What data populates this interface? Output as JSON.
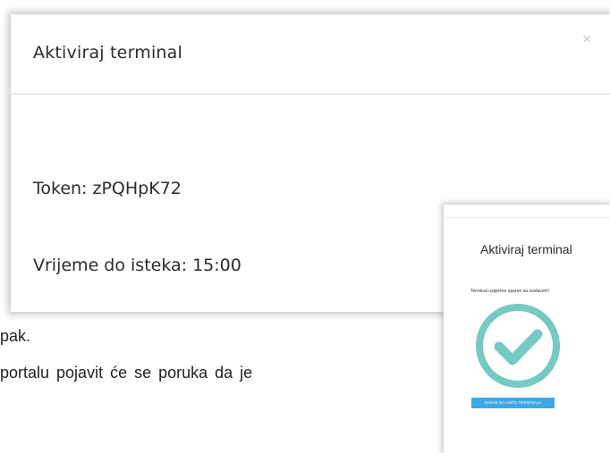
{
  "main_modal": {
    "title": "Aktiviraj terminal",
    "close_icon": "×",
    "token_text": "Token: zPQHpK72",
    "expiry_text": "Vrijeme do isteka: 15:00"
  },
  "document": {
    "line_1": "pak.",
    "line_2": "portalu pojavit će se poruka da je"
  },
  "success_modal": {
    "title": "Aktiviraj terminal",
    "message": "Terminal uspješno uparen sa sustavom!",
    "button_label": "NAZAD NA LISTU TERMINALA",
    "check_color": "#75cac2",
    "button_color": "#3fa9e6"
  }
}
